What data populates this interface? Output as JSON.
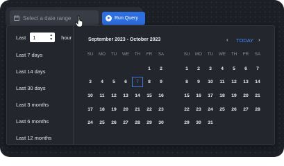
{
  "topbar": {
    "date_placeholder": "Select a date range",
    "run_label": "Run Query"
  },
  "presets": {
    "last_prefix": "Last",
    "last_value": "1",
    "last_unit": "hour",
    "items": [
      "Last 7 days",
      "Last 14 days",
      "Last 30 days",
      "Last 3 months",
      "Last 6 months",
      "Last 12 months"
    ]
  },
  "calendar": {
    "header": "September 2023 - October 2023",
    "today_label": "TODAY",
    "weekdays": [
      "SU",
      "MO",
      "TU",
      "WE",
      "TH",
      "FR",
      "SA"
    ],
    "selected_day": "7",
    "months": [
      {
        "name": "September 2023",
        "rows": [
          [
            "",
            "",
            "",
            "",
            "",
            "1",
            "2"
          ],
          [
            "3",
            "4",
            "5",
            "6",
            "7",
            "8",
            "9"
          ],
          [
            "10",
            "11",
            "12",
            "13",
            "14",
            "15",
            "16"
          ],
          [
            "17",
            "18",
            "19",
            "20",
            "21",
            "22",
            "23"
          ],
          [
            "24",
            "25",
            "26",
            "27",
            "28",
            "29",
            "30"
          ]
        ]
      },
      {
        "name": "October 2023",
        "rows": [
          [
            "1",
            "2",
            "3",
            "4",
            "5",
            "6",
            "7"
          ],
          [
            "8",
            "9",
            "10",
            "11",
            "12",
            "13",
            "14"
          ],
          [
            "15",
            "16",
            "17",
            "18",
            "19",
            "20",
            "21"
          ],
          [
            "22",
            "23",
            "24",
            "25",
            "26",
            "27",
            "28"
          ],
          [
            "29",
            "30",
            "31",
            "",
            "",
            "",
            ""
          ]
        ]
      }
    ]
  },
  "icons": {
    "calendar": "calendar-icon",
    "play": "play-circle-icon",
    "cursor": "hand-pointer-icon",
    "prev": "chevron-left-icon",
    "next": "chevron-right-icon",
    "stepper": "stepper-arrows-icon"
  },
  "colors": {
    "accent": "#2d6fe0",
    "today_link": "#4a8af4",
    "panel_bg": "#23262d",
    "page_bg": "#1c1f26"
  }
}
